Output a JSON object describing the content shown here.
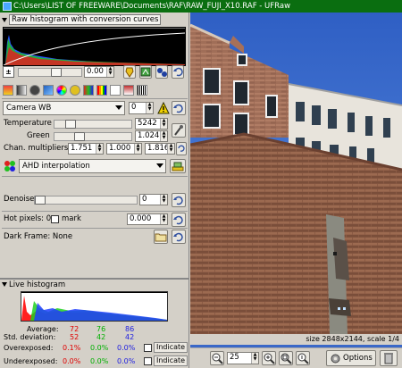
{
  "window": {
    "title": "C:\\Users\\LIST OF FREEWARE\\Documents\\RAF\\RAW_FUJI_X10.RAF - UFRaw"
  },
  "raw_histogram": {
    "title": "Raw histogram with conversion curves"
  },
  "exposure": {
    "value": "0.00"
  },
  "white_balance": {
    "preset": "Camera WB",
    "fine_tune": "0",
    "temperature_label": "Temperature",
    "temperature_value": "5242",
    "green_label": "Green",
    "green_value": "1.024",
    "multipliers_label": "Chan. multipliers",
    "multipliers": [
      "1.751",
      "1.000",
      "1.816"
    ]
  },
  "interpolation": {
    "value": "AHD interpolation"
  },
  "denoise": {
    "label": "Denoise",
    "value": "0"
  },
  "hot_pixels": {
    "label": "Hot pixels: 0",
    "mark_label": "mark",
    "value": "0.000"
  },
  "dark_frame": {
    "label": "Dark Frame: None"
  },
  "live_histogram": {
    "title": "Live histogram"
  },
  "stats": {
    "average_label": "Average:",
    "average": [
      "72",
      "76",
      "86"
    ],
    "std_label": "Std. deviation:",
    "std": [
      "52",
      "42",
      "42"
    ],
    "over_label": "Overexposed:",
    "over": [
      "0.1%",
      "0.0%",
      "0.0%"
    ],
    "under_label": "Underexposed:",
    "under": [
      "0.0%",
      "0.0%",
      "0.0%"
    ],
    "indicate_label": "Indicate",
    "colors": {
      "red": "#e00000",
      "green": "#00b000",
      "blue": "#2020e0"
    }
  },
  "image_info": {
    "size_text": "size 2848x2144, scale 1/4"
  },
  "zoom": {
    "value": "25"
  },
  "options_label": "Options",
  "icons": [
    "exposure-icon",
    "auto-adjust-icon",
    "settings-icon",
    "reset-icon",
    "picker-icon",
    "warning-icon",
    "open-folder-icon",
    "zoom-out-icon",
    "zoom-in-icon",
    "zoom-fit-icon",
    "zoom-100-icon",
    "delete-icon"
  ],
  "accent": {
    "titlebar": "#0a6e10"
  }
}
